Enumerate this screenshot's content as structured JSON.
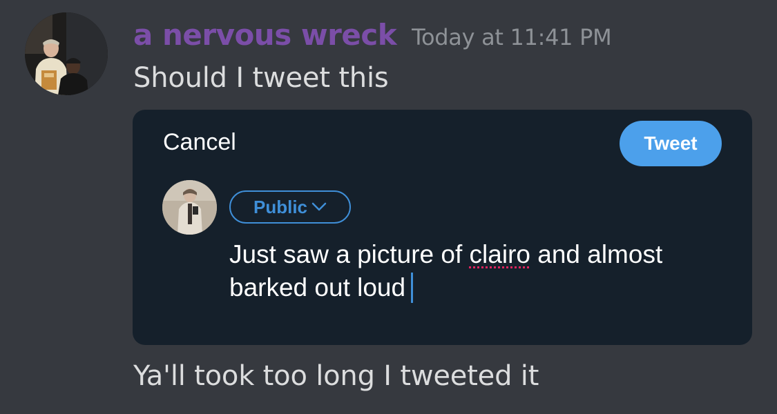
{
  "message": {
    "username": "a nervous wreck",
    "timestamp": "Today at 11:41 PM",
    "text": "Should I tweet this",
    "followup": "Ya'll took too long I tweeted it",
    "username_color": "#7b4ea8"
  },
  "tweet_composer": {
    "cancel_label": "Cancel",
    "tweet_label": "Tweet",
    "audience_label": "Public",
    "audience_icon": "chevron-down-icon",
    "text_before": "Just saw a picture of ",
    "text_misspelled": "clairo",
    "text_after": " and almost barked out loud",
    "accent_color": "#4ca0eb",
    "background_color": "#15202b"
  }
}
